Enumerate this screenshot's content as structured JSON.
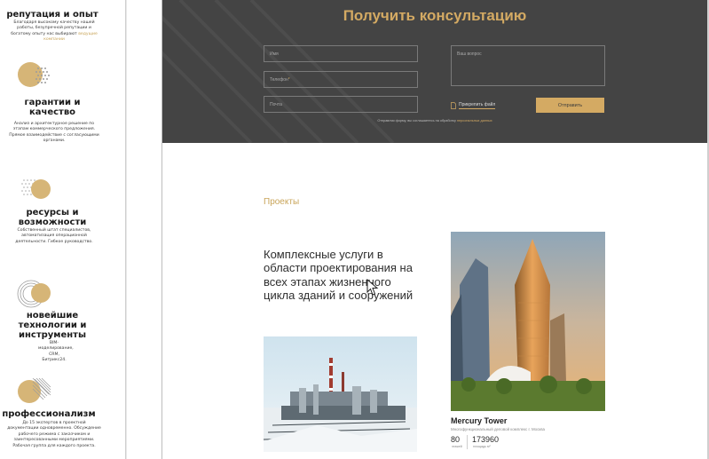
{
  "sidebar": {
    "items": [
      {
        "title": "репутация и опыт",
        "desc": "Благодаря высокому качеству нашей работы, безупречной репутации и богатому опыту нас выбирают",
        "link": "ведущие компании"
      },
      {
        "title": "гарантии и качество",
        "desc": "Анализ и архитектурное решение по этапам коммерческого предложения. Прямое взаимодействие с согласующими органами."
      },
      {
        "title": "ресурсы и возможности",
        "desc": "Собственный штат специалистов, автоматизация операционной деятельности. Гибкое руководство."
      },
      {
        "title": "новейшие технологии и инструменты",
        "desc": "BIM-моделирование, CRM, Битрикс24."
      },
      {
        "title": "профессионализм",
        "desc": "До 15 экспертов в проектной документации одновременно. Обсуждение рабочего режима с заказчиком и заинтересованными мероприятиями. Рабочая группа для каждого проекта."
      }
    ]
  },
  "consult": {
    "title": "Получить консультацию",
    "name_placeholder": "Имя",
    "phone_placeholder": "Телефон",
    "phone_required": "*",
    "email_placeholder": "Почта",
    "message_placeholder": "Ваш вопрос",
    "attach_label": "Прикрепить файл",
    "send_label": "Отправить",
    "consent_text": "Отправляя форму, вы соглашаетесь на обработку",
    "consent_link": "персональных данных"
  },
  "projects": {
    "label": "Проекты",
    "heading": "Комплексные услуги в области проектирования на всех этапах жизненного цикла зданий и сооружений",
    "card": {
      "title": "Mercury Tower",
      "subtitle": "Многофункциональный деловой комплекс г. Москва",
      "stat1_value": "80",
      "stat1_caption": "этажей",
      "stat2_value": "173960",
      "stat2_caption": "площадь м²"
    }
  },
  "colors": {
    "accent": "#d4aa63",
    "dark_panel": "#444444"
  },
  "icons": [
    "circle-dots-icon",
    "circle-stripes-icon",
    "mouse-cursor-icon",
    "file-icon"
  ]
}
